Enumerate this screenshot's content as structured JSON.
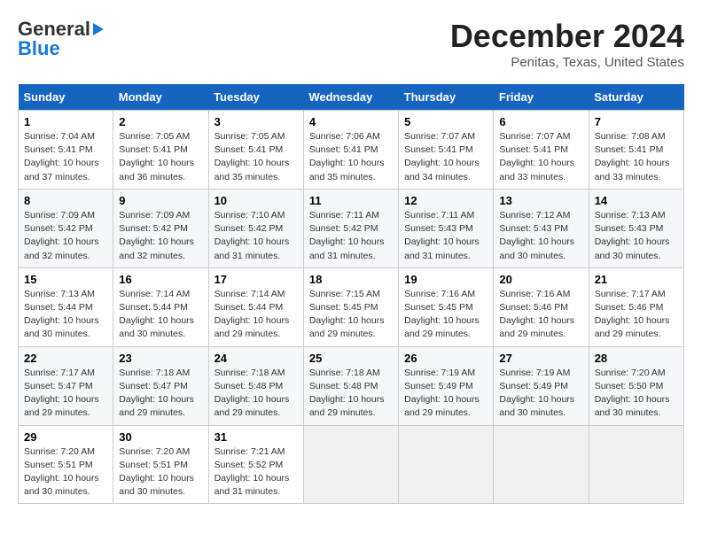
{
  "header": {
    "logo_line1": "General",
    "logo_line2": "Blue",
    "month": "December 2024",
    "location": "Penitas, Texas, United States"
  },
  "weekdays": [
    "Sunday",
    "Monday",
    "Tuesday",
    "Wednesday",
    "Thursday",
    "Friday",
    "Saturday"
  ],
  "weeks": [
    [
      {
        "day": "1",
        "sunrise": "Sunrise: 7:04 AM",
        "sunset": "Sunset: 5:41 PM",
        "daylight": "Daylight: 10 hours and 37 minutes."
      },
      {
        "day": "2",
        "sunrise": "Sunrise: 7:05 AM",
        "sunset": "Sunset: 5:41 PM",
        "daylight": "Daylight: 10 hours and 36 minutes."
      },
      {
        "day": "3",
        "sunrise": "Sunrise: 7:05 AM",
        "sunset": "Sunset: 5:41 PM",
        "daylight": "Daylight: 10 hours and 35 minutes."
      },
      {
        "day": "4",
        "sunrise": "Sunrise: 7:06 AM",
        "sunset": "Sunset: 5:41 PM",
        "daylight": "Daylight: 10 hours and 35 minutes."
      },
      {
        "day": "5",
        "sunrise": "Sunrise: 7:07 AM",
        "sunset": "Sunset: 5:41 PM",
        "daylight": "Daylight: 10 hours and 34 minutes."
      },
      {
        "day": "6",
        "sunrise": "Sunrise: 7:07 AM",
        "sunset": "Sunset: 5:41 PM",
        "daylight": "Daylight: 10 hours and 33 minutes."
      },
      {
        "day": "7",
        "sunrise": "Sunrise: 7:08 AM",
        "sunset": "Sunset: 5:41 PM",
        "daylight": "Daylight: 10 hours and 33 minutes."
      }
    ],
    [
      {
        "day": "8",
        "sunrise": "Sunrise: 7:09 AM",
        "sunset": "Sunset: 5:42 PM",
        "daylight": "Daylight: 10 hours and 32 minutes."
      },
      {
        "day": "9",
        "sunrise": "Sunrise: 7:09 AM",
        "sunset": "Sunset: 5:42 PM",
        "daylight": "Daylight: 10 hours and 32 minutes."
      },
      {
        "day": "10",
        "sunrise": "Sunrise: 7:10 AM",
        "sunset": "Sunset: 5:42 PM",
        "daylight": "Daylight: 10 hours and 31 minutes."
      },
      {
        "day": "11",
        "sunrise": "Sunrise: 7:11 AM",
        "sunset": "Sunset: 5:42 PM",
        "daylight": "Daylight: 10 hours and 31 minutes."
      },
      {
        "day": "12",
        "sunrise": "Sunrise: 7:11 AM",
        "sunset": "Sunset: 5:43 PM",
        "daylight": "Daylight: 10 hours and 31 minutes."
      },
      {
        "day": "13",
        "sunrise": "Sunrise: 7:12 AM",
        "sunset": "Sunset: 5:43 PM",
        "daylight": "Daylight: 10 hours and 30 minutes."
      },
      {
        "day": "14",
        "sunrise": "Sunrise: 7:13 AM",
        "sunset": "Sunset: 5:43 PM",
        "daylight": "Daylight: 10 hours and 30 minutes."
      }
    ],
    [
      {
        "day": "15",
        "sunrise": "Sunrise: 7:13 AM",
        "sunset": "Sunset: 5:44 PM",
        "daylight": "Daylight: 10 hours and 30 minutes."
      },
      {
        "day": "16",
        "sunrise": "Sunrise: 7:14 AM",
        "sunset": "Sunset: 5:44 PM",
        "daylight": "Daylight: 10 hours and 30 minutes."
      },
      {
        "day": "17",
        "sunrise": "Sunrise: 7:14 AM",
        "sunset": "Sunset: 5:44 PM",
        "daylight": "Daylight: 10 hours and 29 minutes."
      },
      {
        "day": "18",
        "sunrise": "Sunrise: 7:15 AM",
        "sunset": "Sunset: 5:45 PM",
        "daylight": "Daylight: 10 hours and 29 minutes."
      },
      {
        "day": "19",
        "sunrise": "Sunrise: 7:16 AM",
        "sunset": "Sunset: 5:45 PM",
        "daylight": "Daylight: 10 hours and 29 minutes."
      },
      {
        "day": "20",
        "sunrise": "Sunrise: 7:16 AM",
        "sunset": "Sunset: 5:46 PM",
        "daylight": "Daylight: 10 hours and 29 minutes."
      },
      {
        "day": "21",
        "sunrise": "Sunrise: 7:17 AM",
        "sunset": "Sunset: 5:46 PM",
        "daylight": "Daylight: 10 hours and 29 minutes."
      }
    ],
    [
      {
        "day": "22",
        "sunrise": "Sunrise: 7:17 AM",
        "sunset": "Sunset: 5:47 PM",
        "daylight": "Daylight: 10 hours and 29 minutes."
      },
      {
        "day": "23",
        "sunrise": "Sunrise: 7:18 AM",
        "sunset": "Sunset: 5:47 PM",
        "daylight": "Daylight: 10 hours and 29 minutes."
      },
      {
        "day": "24",
        "sunrise": "Sunrise: 7:18 AM",
        "sunset": "Sunset: 5:48 PM",
        "daylight": "Daylight: 10 hours and 29 minutes."
      },
      {
        "day": "25",
        "sunrise": "Sunrise: 7:18 AM",
        "sunset": "Sunset: 5:48 PM",
        "daylight": "Daylight: 10 hours and 29 minutes."
      },
      {
        "day": "26",
        "sunrise": "Sunrise: 7:19 AM",
        "sunset": "Sunset: 5:49 PM",
        "daylight": "Daylight: 10 hours and 29 minutes."
      },
      {
        "day": "27",
        "sunrise": "Sunrise: 7:19 AM",
        "sunset": "Sunset: 5:49 PM",
        "daylight": "Daylight: 10 hours and 30 minutes."
      },
      {
        "day": "28",
        "sunrise": "Sunrise: 7:20 AM",
        "sunset": "Sunset: 5:50 PM",
        "daylight": "Daylight: 10 hours and 30 minutes."
      }
    ],
    [
      {
        "day": "29",
        "sunrise": "Sunrise: 7:20 AM",
        "sunset": "Sunset: 5:51 PM",
        "daylight": "Daylight: 10 hours and 30 minutes."
      },
      {
        "day": "30",
        "sunrise": "Sunrise: 7:20 AM",
        "sunset": "Sunset: 5:51 PM",
        "daylight": "Daylight: 10 hours and 30 minutes."
      },
      {
        "day": "31",
        "sunrise": "Sunrise: 7:21 AM",
        "sunset": "Sunset: 5:52 PM",
        "daylight": "Daylight: 10 hours and 31 minutes."
      },
      null,
      null,
      null,
      null
    ]
  ]
}
